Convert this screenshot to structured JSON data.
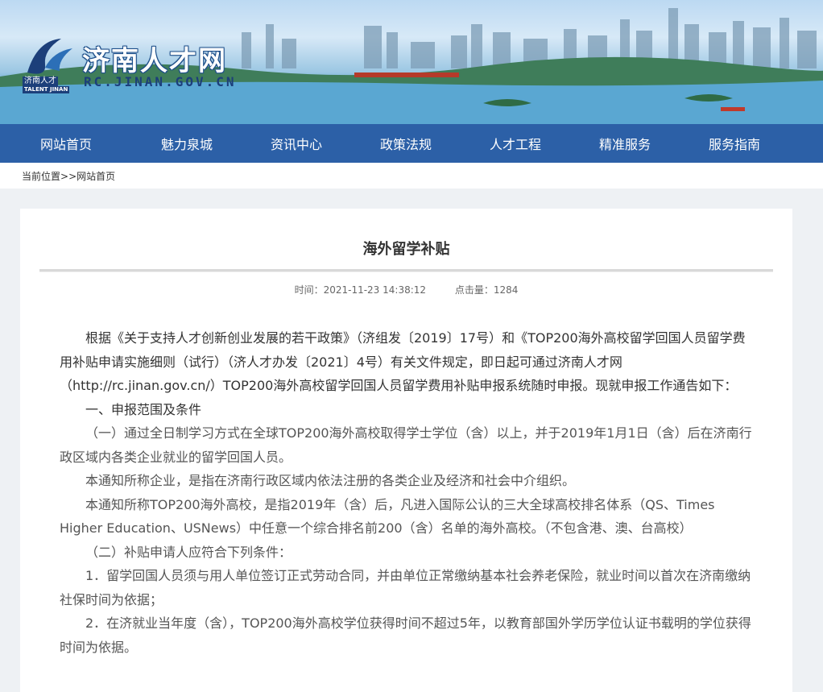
{
  "header": {
    "logo_title": "济南人才网",
    "logo_url": "RC.JINAN.GOV.CN",
    "logo_mark_cn": "济南人才",
    "logo_mark_en": "TALENT JINAN"
  },
  "nav": {
    "items": [
      "网站首页",
      "魅力泉城",
      "资讯中心",
      "政策法规",
      "人才工程",
      "精准服务",
      "服务指南"
    ]
  },
  "breadcrumb": {
    "label": "当前位置",
    "separator": ">>",
    "current": "网站首页"
  },
  "article": {
    "title": "海外留学补贴",
    "time_label": "时间：2021-11-23 14:38:12",
    "hits_label": "点击量：1284",
    "paragraphs": [
      "根据《关于支持人才创新创业发展的若干政策》（济组发〔2019〕17号）和《TOP200海外高校留学回国人员留学费用补贴申请实施细则（试行）（济人才办发〔2021〕4号）有关文件规定，即日起可通过济南人才网（http://rc.jinan.gov.cn/）TOP200海外高校留学回国人员留学费用补贴申报系统随时申报。现就申报工作通告如下：",
      "一、申报范围及条件",
      "（一）通过全日制学习方式在全球TOP200海外高校取得学士学位（含）以上，并于2019年1月1日（含）后在济南行政区域内各类企业就业的留学回国人员。",
      "本通知所称企业，是指在济南行政区域内依法注册的各类企业及经济和社会中介组织。",
      "本通知所称TOP200海外高校，是指2019年（含）后，凡进入国际公认的三大全球高校排名体系（QS、Times Higher Education、USNews）中任意一个综合排名前200（含）名单的海外高校。（不包含港、澳、台高校）",
      "（二）补贴申请人应符合下列条件：",
      "1．留学回国人员须与用人单位签订正式劳动合同，并由单位正常缴纳基本社会养老保险，就业时间以首次在济南缴纳社保时间为依据；",
      "2．在济就业当年度（含），TOP200海外高校学位获得时间不超过5年，以教育部国外学历学位认证书载明的学位获得时间为依据。"
    ]
  },
  "colors": {
    "nav_bg": "#2c60a7",
    "page_bg": "#eef1f4",
    "text": "#333333"
  }
}
